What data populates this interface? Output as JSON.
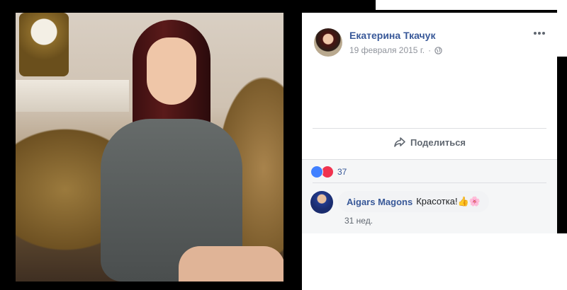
{
  "post": {
    "author": "Екатерина Ткачук",
    "date": "19 февраля 2015 г.",
    "share_label": "Поделиться",
    "reactions_count": "37"
  },
  "comment": {
    "author": "Aigars Magons",
    "text": "Красотка!👍🌸",
    "time": "31 нед."
  },
  "colors": {
    "link_blue": "#385898",
    "like_blue": "#4080ff",
    "love_red": "#f0334f"
  }
}
